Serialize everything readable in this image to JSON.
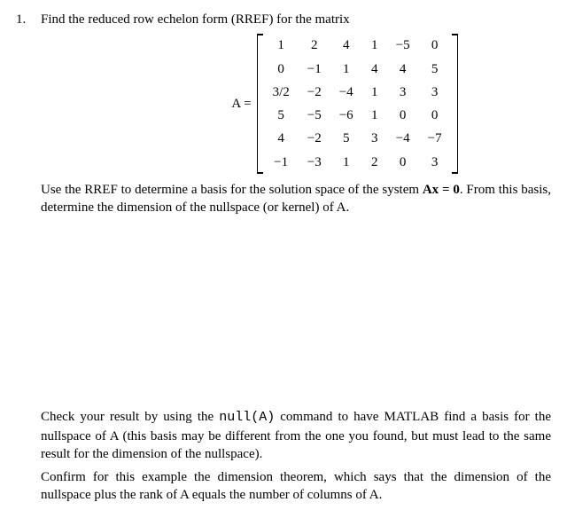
{
  "problem_number": "1.",
  "intro": "Find the reduced row echelon form (RREF) for the matrix",
  "matrix": {
    "label_left": "A = ",
    "rows": [
      [
        "1",
        "2",
        "4",
        "1",
        "−5",
        "0"
      ],
      [
        "0",
        "−1",
        "1",
        "4",
        "4",
        "5"
      ],
      [
        "3/2",
        "−2",
        "−4",
        "1",
        "3",
        "3"
      ],
      [
        "5",
        "−5",
        "−6",
        "1",
        "0",
        "0"
      ],
      [
        "4",
        "−2",
        "5",
        "3",
        "−4",
        "−7"
      ],
      [
        "−1",
        "−3",
        "1",
        "2",
        "0",
        "3"
      ]
    ]
  },
  "para1_a": "Use the RREF to determine a basis for the solution space of the system ",
  "para1_eq": "Ax = 0",
  "para1_b": ". From this basis, determine the dimension of the nullspace (or kernel) of A.",
  "para2_a": "Check your result by using the ",
  "para2_code": "null(A)",
  "para2_b": " command to have MATLAB find a basis for the nullspace of A (this basis may be different from the one you found, but must lead to the same result for the dimension of the nullspace).",
  "para3": "Confirm for this example the dimension theorem, which says that the dimension of the nullspace plus the rank of A equals the number of columns of A."
}
